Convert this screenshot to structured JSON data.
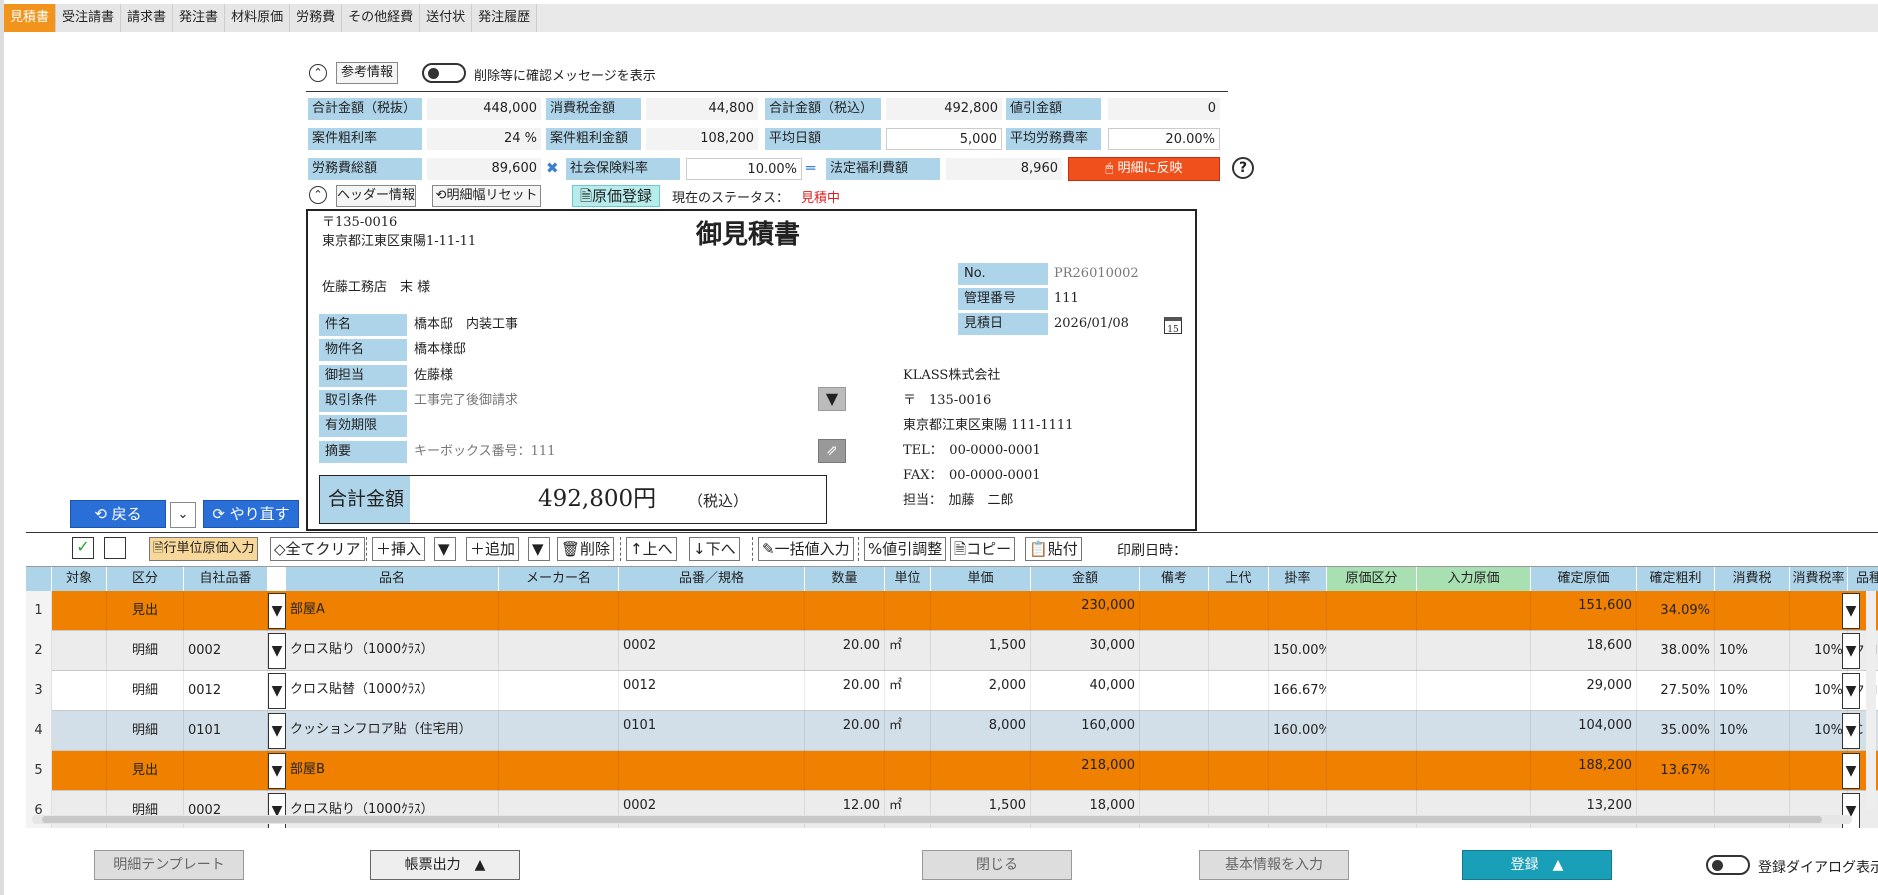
{
  "tabs": [
    "見積書",
    "受注請書",
    "請求書",
    "発注書",
    "材料原価",
    "労務費",
    "その他経費",
    "送付状",
    "発注履歴"
  ],
  "ref": {
    "title": "参考情報",
    "toggle_label": "削除等に確認メッセージを表示"
  },
  "summary": {
    "r1": [
      [
        "合計金額（税抜）",
        "448,000"
      ],
      [
        "消費税金額",
        "44,800"
      ],
      [
        "合計金額（税込）",
        "492,800"
      ],
      [
        "値引金額",
        "0"
      ]
    ],
    "r2": [
      [
        "案件粗利率",
        "24 %"
      ],
      [
        "案件粗利金額",
        "108,200"
      ],
      [
        "平均日額",
        "5,000"
      ],
      [
        "平均労務費率",
        "20.00%"
      ]
    ],
    "r3": {
      "l1": "労務費総額",
      "v1": "89,600",
      "l2": "社会保険料率",
      "v2": "10.00%",
      "l3": "法定福利費額",
      "v3": "8,960",
      "btn": "明細に反映"
    }
  },
  "header": {
    "title": "ヘッダー情報",
    "reset": "明細幅リセット",
    "cost_reg": "原価登録",
    "status_label": "現在のステータス：",
    "status": "見積中"
  },
  "doc": {
    "zip": "〒135-0016",
    "addr": "東京都江東区東陽1-11-11",
    "title": "御見積書",
    "customer": "佐藤工務店　末 様",
    "no_l": "No.",
    "no_v": "PR26010002",
    "mgmt_l": "管理番号",
    "mgmt_v": "111",
    "date_l": "見積日",
    "date_v": "2026/01/08",
    "fields": [
      [
        "件名",
        "橋本邸　内装工事"
      ],
      [
        "物件名",
        "橋本様邸"
      ],
      [
        "御担当",
        "佐藤様"
      ],
      [
        "取引条件",
        "工事完了後御請求"
      ],
      [
        "有効期限",
        ""
      ],
      [
        "摘要",
        "キーボックス番号：111"
      ]
    ],
    "company": [
      "KLASS株式会社",
      "〒　135-0016",
      "東京都江東区東陽 111-1111",
      "TEL：　00-0000-0001",
      "FAX：　00-0000-0001",
      "担当：　加藤　二郎"
    ],
    "total_l": "合計金額",
    "total_v": "492,800円",
    "tax": "（税込）"
  },
  "nav": {
    "back": "戻る",
    "redo": "やり直す"
  },
  "toolbar": {
    "unit_cost": "行単位原価入力",
    "clear": "全てクリア",
    "insert": "挿入",
    "add": "追加",
    "delete": "削除",
    "up": "上へ",
    "down": "下へ",
    "bulk": "一括値入力",
    "discount": "値引調整",
    "copy": "コピー",
    "paste": "貼付",
    "print_date": "印刷日時："
  },
  "columns": [
    "対象",
    "区分",
    "自社品番",
    "品名",
    "メーカー名",
    "品番／規格",
    "数量",
    "単位",
    "単価",
    "金額",
    "備考",
    "上代",
    "掛率",
    "原価区分",
    "入力原価",
    "確定原価",
    "確定粗利",
    "消費税",
    "消費税率",
    "品種名"
  ],
  "rows": [
    {
      "n": "1",
      "kubun": "見出",
      "code": "",
      "name": "部屋A",
      "spec": "",
      "qty": "",
      "unit": "",
      "price": "",
      "amount": "230,000",
      "rate": "",
      "cost": "151,600",
      "profit": "34.09%",
      "tax": "",
      "taxrate": "",
      "type": "",
      "style": "head"
    },
    {
      "n": "2",
      "kubun": "明細",
      "code": "0002",
      "name": "クロス貼り（1000ｸﾗｽ）",
      "spec": "0002",
      "qty": "20.00",
      "unit": "㎡",
      "price": "1,500",
      "amount": "30,000",
      "rate": "150.00%",
      "cost": "18,600",
      "profit": "38.00%",
      "tax": "10%",
      "taxrate": "10%",
      "type": "クロス",
      "style": "alt"
    },
    {
      "n": "3",
      "kubun": "明細",
      "code": "0012",
      "name": "クロス貼替（1000ｸﾗｽ）",
      "spec": "0012",
      "qty": "20.00",
      "unit": "㎡",
      "price": "2,000",
      "amount": "40,000",
      "rate": "166.67%",
      "cost": "29,000",
      "profit": "27.50%",
      "tax": "10%",
      "taxrate": "10%",
      "type": "クロス",
      "style": "plain"
    },
    {
      "n": "4",
      "kubun": "明細",
      "code": "0101",
      "name": "クッションフロア貼（住宅用）",
      "spec": "0101",
      "qty": "20.00",
      "unit": "㎡",
      "price": "8,000",
      "amount": "160,000",
      "rate": "160.00%",
      "cost": "104,000",
      "profit": "35.00%",
      "tax": "10%",
      "taxrate": "10%",
      "type": "ＣＦ",
      "style": "sel"
    },
    {
      "n": "5",
      "kubun": "見出",
      "code": "",
      "name": "部屋B",
      "spec": "",
      "qty": "",
      "unit": "",
      "price": "",
      "amount": "218,000",
      "rate": "",
      "cost": "188,200",
      "profit": "13.67%",
      "tax": "",
      "taxrate": "",
      "type": "",
      "style": "head"
    },
    {
      "n": "6",
      "kubun": "明細",
      "code": "0002",
      "name": "クロス貼り（1000ｸﾗｽ）",
      "spec": "0002",
      "qty": "12.00",
      "unit": "㎡",
      "price": "1,500",
      "amount": "18,000",
      "rate": "",
      "cost": "13,200",
      "profit": "",
      "tax": "",
      "taxrate": "",
      "type": "",
      "style": "alt"
    }
  ],
  "bottom": {
    "template": "明細テンプレート",
    "output": "帳票出力",
    "close": "閉じる",
    "basic": "基本情報を入力",
    "register": "登録",
    "reg_dialog": "登録ダイアログ表示"
  },
  "colors": {
    "accent": "#f2941c",
    "orange_row": "#f08000",
    "header_blue": "#aed4ea",
    "register": "#1a9fb8",
    "reflect": "#f0501c"
  }
}
